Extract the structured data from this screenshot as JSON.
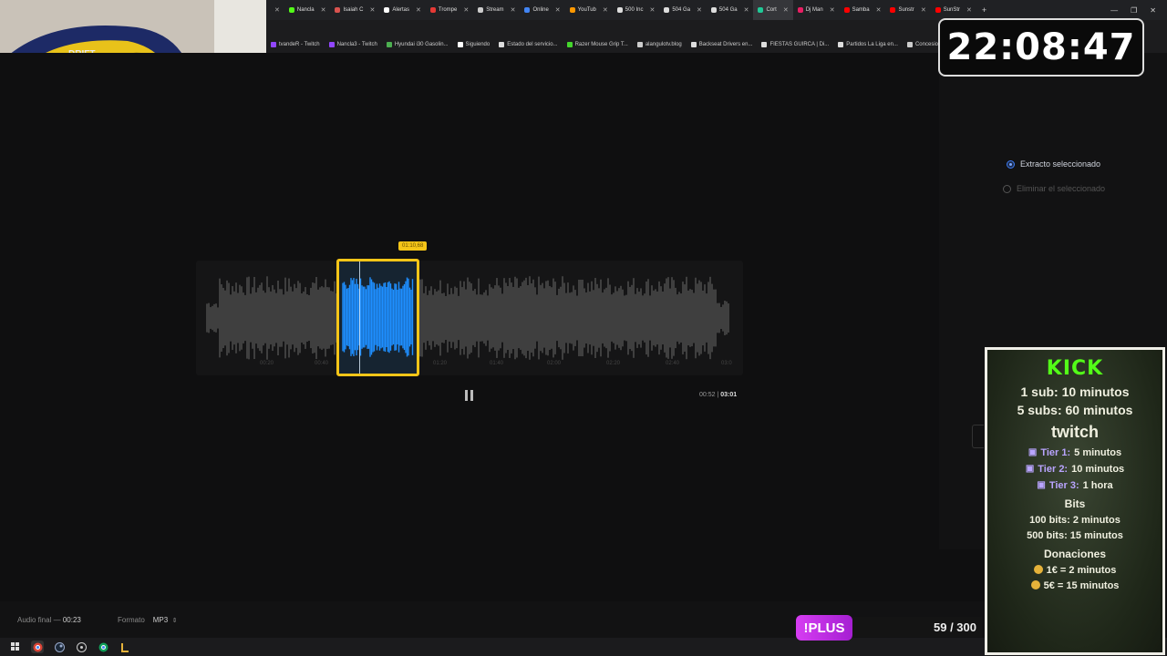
{
  "tabs": [
    {
      "label": "Nancla",
      "color": "#53fc18"
    },
    {
      "label": "Isaiah C",
      "color": "#d9534f"
    },
    {
      "label": "Alertas",
      "color": "#ffffff"
    },
    {
      "label": "Trompe",
      "color": "#e53935"
    },
    {
      "label": "Stream",
      "color": "#cccccc"
    },
    {
      "label": "Online",
      "color": "#4285f4"
    },
    {
      "label": "YouTub",
      "color": "#ff9800"
    },
    {
      "label": "500 Inc",
      "color": "#dddddd"
    },
    {
      "label": "504 Ga",
      "color": "#dddddd"
    },
    {
      "label": "504 Ga",
      "color": "#dddddd"
    },
    {
      "label": "Cort",
      "color": "#20c997",
      "active": true
    },
    {
      "label": "Dj Man",
      "color": "#e91e63"
    },
    {
      "label": "Samba",
      "color": "#ff0000"
    },
    {
      "label": "Sunstr",
      "color": "#ff0000"
    },
    {
      "label": "SunStr",
      "color": "#ff0000"
    }
  ],
  "bookmarks": [
    {
      "label": "tvandeR - Twitch",
      "color": "#9146ff"
    },
    {
      "label": "Nancla3 - Twitch",
      "color": "#9146ff"
    },
    {
      "label": "Hyundai i30 Gasolin...",
      "color": "#4caf50"
    },
    {
      "label": "Siguiendo",
      "color": "#ffffff"
    },
    {
      "label": "Estado del servicio...",
      "color": "#dddddd"
    },
    {
      "label": "Razer Mouse Grip T...",
      "color": "#44d62c"
    },
    {
      "label": "alangulotv.blog",
      "color": "#cccccc"
    },
    {
      "label": "Backseat Drivers en...",
      "color": "#dddddd"
    },
    {
      "label": "FIESTAS GUIRCA | Di...",
      "color": "#dddddd"
    },
    {
      "label": "Partidos La Liga en...",
      "color": "#dddddd"
    },
    {
      "label": "Concesion",
      "color": "#cccccc"
    }
  ],
  "options": {
    "keep_selected": "Extracto seleccionado",
    "delete_selected": "Eliminar el seleccionado"
  },
  "waveform": {
    "selection_label": "01:10,68",
    "ticks": [
      "00:20",
      "00:40",
      "01:00",
      "01:20",
      "01:40",
      "02:00",
      "02:20",
      "02:40",
      "03:0"
    ],
    "current_time": "00:52",
    "total_time": "03:01"
  },
  "bottom": {
    "audio_final_label": "Audio final",
    "audio_final_sep": "—",
    "audio_final_value": "00:23",
    "format_label": "Formato",
    "format_value": "MP3",
    "format_arrow": "⇕"
  },
  "clock": "22:08:47",
  "sub_panel": {
    "kick": "KICK",
    "kick_line1": "1 sub: 10 minutos",
    "kick_line2": "5 subs: 60 minutos",
    "twitch": "twitch",
    "tier1_label": "Tier 1:",
    "tier1_value": "5 minutos",
    "tier2_label": "Tier 2:",
    "tier2_value": "10 minutos",
    "tier3_label": "Tier 3:",
    "tier3_value": "1 hora",
    "bits_header": "Bits",
    "bits1": "100 bits: 2 minutos",
    "bits2": "500 bits: 15 minutos",
    "donations_header": "Donaciones",
    "don1": "1€ = 2 minutos",
    "don2": "5€ = 15 minutos"
  },
  "plus": {
    "label": "!PLUS",
    "count": "59 / 300"
  },
  "window_controls": [
    "—",
    "❐",
    "✕"
  ],
  "new_tab": "+"
}
